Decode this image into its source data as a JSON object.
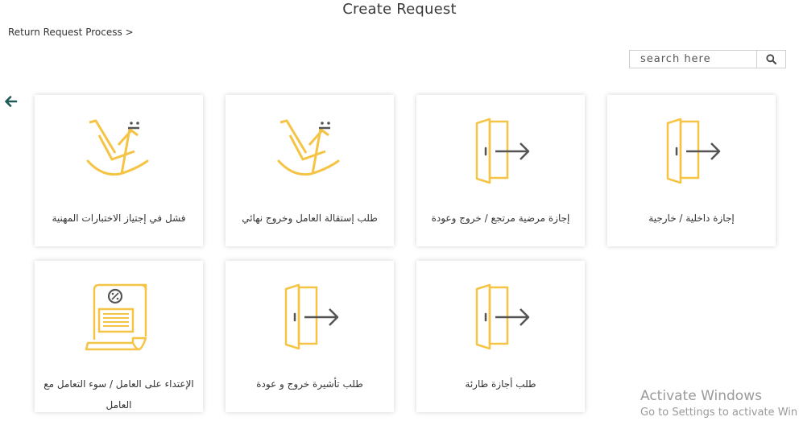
{
  "page": {
    "title": "Create Request"
  },
  "breadcrumb": {
    "text": "Return Request Process >"
  },
  "search": {
    "placeholder": "search here"
  },
  "colors": {
    "accent": "#f5c444",
    "arrow": "#555555",
    "back": "#1f5b58"
  },
  "cards": [
    {
      "label": "إجازة داخلية / خارجية",
      "icon": "exit-door-icon"
    },
    {
      "label": "إجازة مرضية مرتجع / خروج وعودة",
      "icon": "exit-door-icon"
    },
    {
      "label": "طلب إستقالة العامل وخروج نهائي",
      "icon": "rocking-chair-icon"
    },
    {
      "label": "فشل في إجتياز الاختبارات المهنية",
      "icon": "rocking-chair-icon"
    },
    {
      "label": "طلب أجازة طارئة",
      "icon": "exit-door-icon"
    },
    {
      "label": "طلب تأشيرة خروج و عودة",
      "icon": "exit-door-icon"
    },
    {
      "label": "الإعتداء على العامل / سوء التعامل مع العامل",
      "icon": "document-percent-icon"
    }
  ],
  "watermark": {
    "line1": "Activate Windows",
    "line2": "Go to Settings to activate Win"
  }
}
